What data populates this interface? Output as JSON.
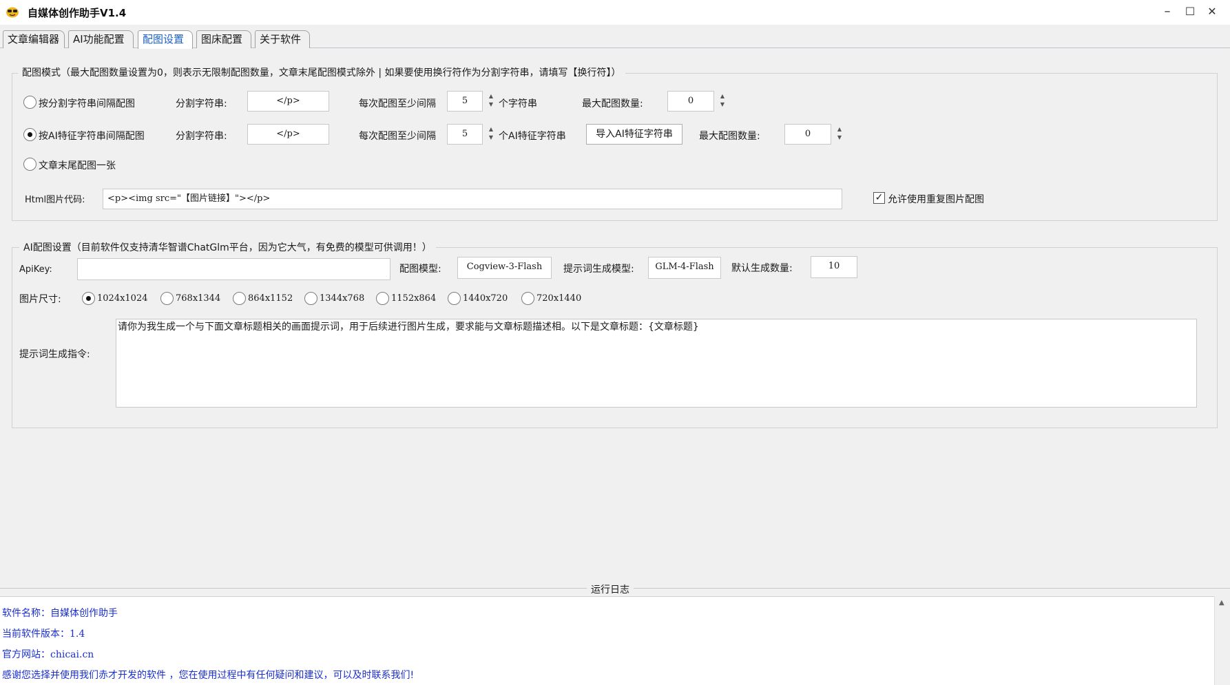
{
  "window": {
    "title": "自媒体创作助手V1.4",
    "minimize": "–",
    "maximize": "☐",
    "close": "✕"
  },
  "tabs": [
    {
      "label": "文章编辑器"
    },
    {
      "label": "AI功能配置"
    },
    {
      "label": "配图设置",
      "active": true
    },
    {
      "label": "图床配置"
    },
    {
      "label": "关于软件"
    }
  ],
  "mode_group": {
    "legend": "配图模式（最大配图数量设置为0，则表示无限制配图数量，文章末尾配图模式除外    |   如果要使用换行符作为分割字符串，请填写【换行符】）",
    "row1": {
      "radio_label": "按分割字符串间隔配图",
      "split_label": "分割字符串:",
      "split_value": "</p>",
      "interval_label": "每次配图至少间隔",
      "interval_value": "5",
      "unit_label": "个字符串",
      "max_label": "最大配图数量:",
      "max_value": "0"
    },
    "row2": {
      "radio_label": "按AI特征字符串间隔配图",
      "split_label": "分割字符串:",
      "split_value": "</p>",
      "interval_label": "每次配图至少间隔",
      "interval_value": "5",
      "unit_label": "个AI特征字符串",
      "import_button": "导入AI特征字符串",
      "max_label": "最大配图数量:",
      "max_value": "0"
    },
    "row3": {
      "radio_label": "文章末尾配图一张"
    },
    "html_label": "Html图片代码:",
    "html_value": "<p><img src=\"【图片链接】\"></p>",
    "allow_repeat_label": "允许使用重复图片配图",
    "allow_repeat_checked": "✓"
  },
  "ai_group": {
    "legend": "AI配图设置（目前软件仅支持清华智谱ChatGlm平台，因为它大气，有免费的模型可供调用！）",
    "apikey_label": "ApiKey:",
    "apikey_value": "",
    "model_label": "配图模型:",
    "model_value": "Cogview-3-Flash",
    "prompt_model_label": "提示词生成模型:",
    "prompt_model_value": "GLM-4-Flash",
    "count_label": "默认生成数量:",
    "count_value": "10",
    "size_label": "图片尺寸:",
    "sizes": [
      "1024x1024",
      "768x1344",
      "864x1152",
      "1344x768",
      "1152x864",
      "1440x720",
      "720x1440"
    ],
    "selected_size": "1024x1024",
    "instruction_label": "提示词生成指令:",
    "instruction_value": "请你为我生成一个与下面文章标题相关的画面提示词，用于后续进行图片生成，要求能与文章标题描述相。以下是文章标题：{文章标题}"
  },
  "log": {
    "title": "运行日志",
    "lines": [
      "软件名称：自媒体创作助手",
      "当前软件版本：1.4",
      "官方网站：chicai.cn",
      "感谢您选择并使用我们赤才开发的软件 ，您在使用过程中有任何疑问和建议，可以及时联系我们!"
    ]
  }
}
